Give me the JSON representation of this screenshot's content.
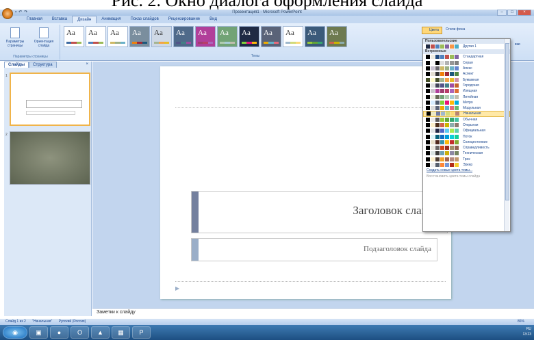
{
  "caption": "Рис. 2. Окно диалога оформления слайда",
  "window": {
    "title": "Презентация1 - Microsoft PowerPoint"
  },
  "tabs": [
    "Главная",
    "Вставка",
    "Дизайн",
    "Анимация",
    "Показ слайдов",
    "Рецензирование",
    "Вид"
  ],
  "active_tab": "Дизайн",
  "ribbon": {
    "page_setup": {
      "btn1": "Параметры страницы",
      "btn2": "Ориентация слайда",
      "group": "Параметры страницы"
    },
    "themes_group": "Темы",
    "theme_tile_label": "Aa",
    "colors_btn": "Цвета",
    "fonts_btn": "Стили фона",
    "right_label": "вки"
  },
  "left_pane": {
    "tabs": [
      "Слайды",
      "Структура"
    ],
    "slide_numbers": [
      "1",
      "2"
    ]
  },
  "slide": {
    "title": "Заголовок слайда",
    "subtitle": "Подзаголовок слайда"
  },
  "notes": "Заметки к слайду",
  "status": {
    "slide": "Слайд 1 из 2",
    "theme": "\"Начальная\"",
    "lang": "Русский (Россия)",
    "zoom": "86%"
  },
  "taskbar": {
    "lang": "RU",
    "time": "13:23"
  },
  "colors_dropdown": {
    "custom_header": "Пользовательские",
    "custom": [
      {
        "name": "Другая 1",
        "colors": [
          "#ffffff",
          "#1f2a44",
          "#c0504d",
          "#4f81bd",
          "#9bbb59",
          "#8064a2",
          "#f79646",
          "#4bacc6"
        ]
      }
    ],
    "builtin_header": "Встроенные",
    "builtin": [
      {
        "name": "Стандартная",
        "colors": [
          "#ffffff",
          "#000000",
          "#eeece1",
          "#1f497d",
          "#4f81bd",
          "#c0504d",
          "#9bbb59",
          "#8064a2"
        ]
      },
      {
        "name": "Серая",
        "colors": [
          "#ffffff",
          "#000000",
          "#f8f8f8",
          "#000000",
          "#dddddd",
          "#b2b2b2",
          "#969696",
          "#808080"
        ]
      },
      {
        "name": "Апекс",
        "colors": [
          "#ffffff",
          "#000000",
          "#c9c2d1",
          "#69676d",
          "#ceb966",
          "#9cb084",
          "#6bb1c9",
          "#6585cf"
        ]
      },
      {
        "name": "Аспект",
        "colors": [
          "#ffffff",
          "#000000",
          "#e3ded1",
          "#323232",
          "#f07f09",
          "#9f2936",
          "#1b587c",
          "#4e8542"
        ]
      },
      {
        "name": "Бумажная",
        "colors": [
          "#ffffff",
          "#444d26",
          "#fefac9",
          "#444d26",
          "#a5b592",
          "#f3a447",
          "#e7bc29",
          "#d092a7"
        ]
      },
      {
        "name": "Городская",
        "colors": [
          "#ffffff",
          "#000000",
          "#dedede",
          "#424456",
          "#53548a",
          "#438086",
          "#a04da3",
          "#c4652d"
        ]
      },
      {
        "name": "Изящная",
        "colors": [
          "#ffffff",
          "#000000",
          "#ccc3cd",
          "#b13f9a",
          "#9e3e6f",
          "#b83d68",
          "#ac66bb",
          "#de6c36"
        ]
      },
      {
        "name": "Литейная",
        "colors": [
          "#ffffff",
          "#000000",
          "#eaebde",
          "#676a55",
          "#72a376",
          "#b0ccb0",
          "#a8cdd7",
          "#c0beaf"
        ]
      },
      {
        "name": "Метро",
        "colors": [
          "#ffffff",
          "#000000",
          "#d6ecff",
          "#4e5b6f",
          "#7fd13b",
          "#ea157a",
          "#feb80a",
          "#00addc"
        ]
      },
      {
        "name": "Модульная",
        "colors": [
          "#ffffff",
          "#000000",
          "#dadada",
          "#5a6378",
          "#f0ad00",
          "#60b5cc",
          "#e66c7d",
          "#6bb76d"
        ]
      },
      {
        "name": "Начальная",
        "colors": [
          "#ffffff",
          "#000000",
          "#ece9c6",
          "#727ca3",
          "#9fb8cd",
          "#d2da7a",
          "#fada7a",
          "#b88472"
        ]
      },
      {
        "name": "Обычная",
        "colors": [
          "#ffffff",
          "#000000",
          "#ebebeb",
          "#5a5a5a",
          "#99cb38",
          "#63a537",
          "#37a76f",
          "#44c1a3"
        ]
      },
      {
        "name": "Открытая",
        "colors": [
          "#ffffff",
          "#000000",
          "#fbeec9",
          "#4d2f1b",
          "#d16349",
          "#ccb400",
          "#8cadae",
          "#8c7b70"
        ]
      },
      {
        "name": "Официальная",
        "colors": [
          "#ffffff",
          "#000000",
          "#dfe3e5",
          "#212745",
          "#4e67c8",
          "#5eccf3",
          "#a7ea52",
          "#5dceaf"
        ]
      },
      {
        "name": "Поток",
        "colors": [
          "#ffffff",
          "#000000",
          "#dbf5f9",
          "#04617b",
          "#0f6fc6",
          "#009dd9",
          "#0bd0d9",
          "#10cf9b"
        ]
      },
      {
        "name": "Солнцестояние",
        "colors": [
          "#ffffff",
          "#000000",
          "#e7dec9",
          "#4f271c",
          "#3891a7",
          "#feb80a",
          "#c32d2e",
          "#84aa33"
        ]
      },
      {
        "name": "Справедливость",
        "colors": [
          "#ffffff",
          "#000000",
          "#e9e5dc",
          "#696464",
          "#d34817",
          "#9b2d1f",
          "#a28e6a",
          "#956251"
        ]
      },
      {
        "name": "Техническая",
        "colors": [
          "#ffffff",
          "#000000",
          "#d9e2e2",
          "#3b3b3b",
          "#6ea0b0",
          "#ccaf0a",
          "#8d89a4",
          "#748560"
        ]
      },
      {
        "name": "Трек",
        "colors": [
          "#ffffff",
          "#000000",
          "#fbeec9",
          "#4e3b30",
          "#f0a22e",
          "#a5644e",
          "#b58b80",
          "#c3986d"
        ]
      },
      {
        "name": "Эркер",
        "colors": [
          "#ffffff",
          "#000000",
          "#ededed",
          "#575f6d",
          "#fe8637",
          "#7598d9",
          "#b32c16",
          "#f5cd2d"
        ]
      }
    ],
    "highlighted": "Начальная",
    "create": "Создать новые цвета темы...",
    "reset": "Восстановить цвета темы слайда"
  },
  "theme_palettes": [
    [
      "#ffffff",
      "#3e6aa1",
      "#c0504d",
      "#9bbb59"
    ],
    [
      "#ffffff",
      "#4f81bd",
      "#c0504d",
      "#9bbb59"
    ],
    [
      "#ffffff",
      "#ceb966",
      "#9cb084",
      "#6bb1c9"
    ],
    [
      "#7a8e9e",
      "#f07f09",
      "#9f2936",
      "#1b587c"
    ],
    [
      "#cfd9e6",
      "#a5b592",
      "#f3a447",
      "#e7bc29"
    ],
    [
      "#4f6a8a",
      "#53548a",
      "#438086",
      "#a04da3"
    ],
    [
      "#b13f9a",
      "#9e3e6f",
      "#b83d68",
      "#ac66bb"
    ],
    [
      "#72a376",
      "#b0ccb0",
      "#a8cdd7",
      "#c0beaf"
    ],
    [
      "#1f2a44",
      "#7fd13b",
      "#ea157a",
      "#feb80a"
    ],
    [
      "#5a6378",
      "#f0ad00",
      "#60b5cc",
      "#e66c7d"
    ],
    [
      "#ffffff",
      "#9fb8cd",
      "#d2da7a",
      "#fada7a"
    ],
    [
      "#3b5a7a",
      "#99cb38",
      "#63a537",
      "#37a76f"
    ],
    [
      "#6e7a50",
      "#d16349",
      "#ccb400",
      "#8cadae"
    ]
  ]
}
